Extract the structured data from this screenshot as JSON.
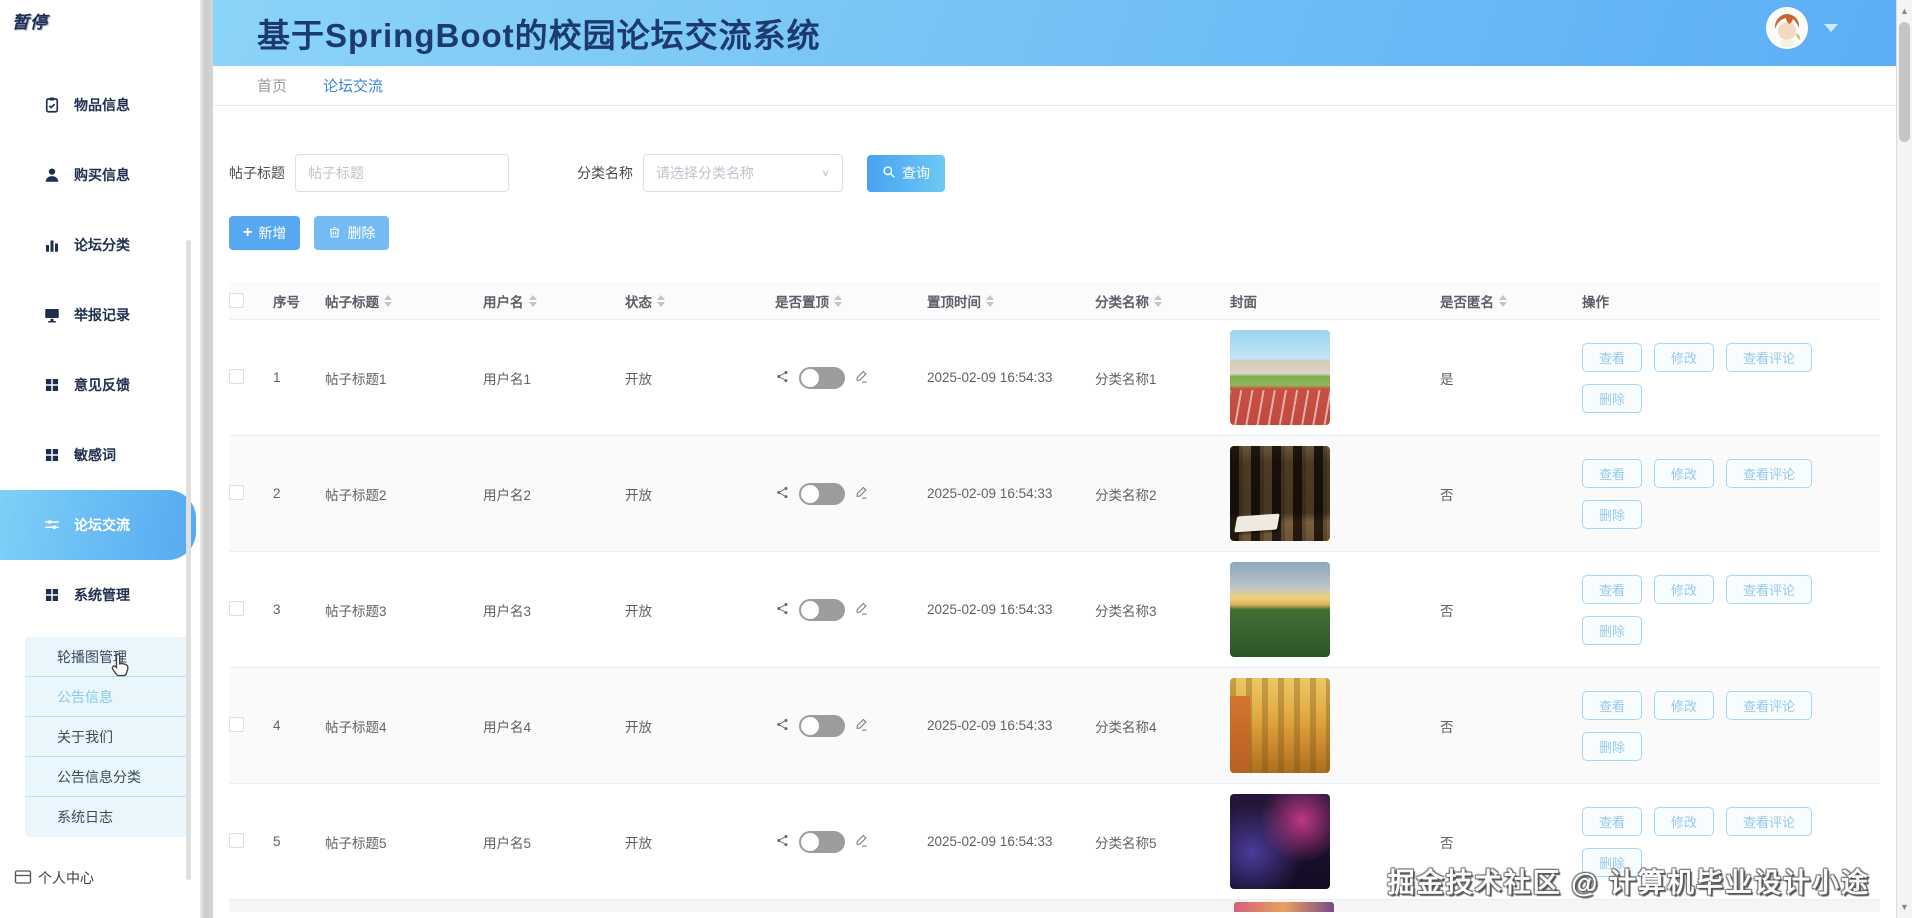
{
  "logo": "暂停",
  "header": {
    "title": "基于SpringBoot的校园论坛交流系统"
  },
  "tabs": {
    "home": "首页",
    "forum": "论坛交流"
  },
  "sidebar": {
    "items": [
      {
        "label": "物品信息"
      },
      {
        "label": "购买信息"
      },
      {
        "label": "论坛分类"
      },
      {
        "label": "举报记录"
      },
      {
        "label": "意见反馈"
      },
      {
        "label": "敏感词"
      },
      {
        "label": "论坛交流"
      },
      {
        "label": "系统管理"
      }
    ],
    "submenu": [
      {
        "label": "轮播图管理"
      },
      {
        "label": "公告信息"
      },
      {
        "label": "关于我们"
      },
      {
        "label": "公告信息分类"
      },
      {
        "label": "系统日志"
      }
    ],
    "personal": "个人中心"
  },
  "search": {
    "title_label": "帖子标题",
    "title_placeholder": "帖子标题",
    "category_label": "分类名称",
    "category_placeholder": "请选择分类名称",
    "query": "查询"
  },
  "toolbar": {
    "add": "新增",
    "remove": "删除"
  },
  "table": {
    "columns": [
      "序号",
      "帖子标题",
      "用户名",
      "状态",
      "是否置顶",
      "置顶时间",
      "分类名称",
      "封面",
      "是否匿名",
      "操作"
    ],
    "actions": {
      "view": "查看",
      "edit": "修改",
      "comments": "查看评论",
      "del": "删除"
    },
    "rows": [
      {
        "no": "1",
        "title": "帖子标题1",
        "user": "用户名1",
        "status": "开放",
        "pinned": false,
        "time": "2025-02-09 16:54:33",
        "category": "分类名称1",
        "cover": "campus-running-track",
        "anonymous": "是"
      },
      {
        "no": "2",
        "title": "帖子标题2",
        "user": "用户名2",
        "status": "开放",
        "pinned": false,
        "time": "2025-02-09 16:54:33",
        "category": "分类名称2",
        "cover": "library-bookshelves",
        "anonymous": "否"
      },
      {
        "no": "3",
        "title": "帖子标题3",
        "user": "用户名3",
        "status": "开放",
        "pinned": false,
        "time": "2025-02-09 16:54:33",
        "category": "分类名称3",
        "cover": "green-field-sunset",
        "anonymous": "否"
      },
      {
        "no": "4",
        "title": "帖子标题4",
        "user": "用户名4",
        "status": "开放",
        "pinned": false,
        "time": "2025-02-09 16:54:33",
        "category": "分类名称4",
        "cover": "autumn-golden-trees",
        "anonymous": "否"
      },
      {
        "no": "5",
        "title": "帖子标题5",
        "user": "用户名5",
        "status": "开放",
        "pinned": false,
        "time": "2025-02-09 16:54:33",
        "category": "分类名称5",
        "cover": "neon-cyberpunk-figures",
        "anonymous": "否"
      }
    ]
  },
  "watermark": "掘金技术社区 @ 计算机毕业设计小途",
  "colors": {
    "header_gradient_start": "#8bd4f7",
    "header_gradient_end": "#5caef5",
    "title_text": "#1c3a6e",
    "active_item_start": "#7ed0f8",
    "active_item_end": "#55a9f0",
    "primary_button": "#57a8f1",
    "action_button_border": "#a9d6f1",
    "action_button_text": "#98c9e9",
    "toggle_off": "#9c9c9c"
  }
}
